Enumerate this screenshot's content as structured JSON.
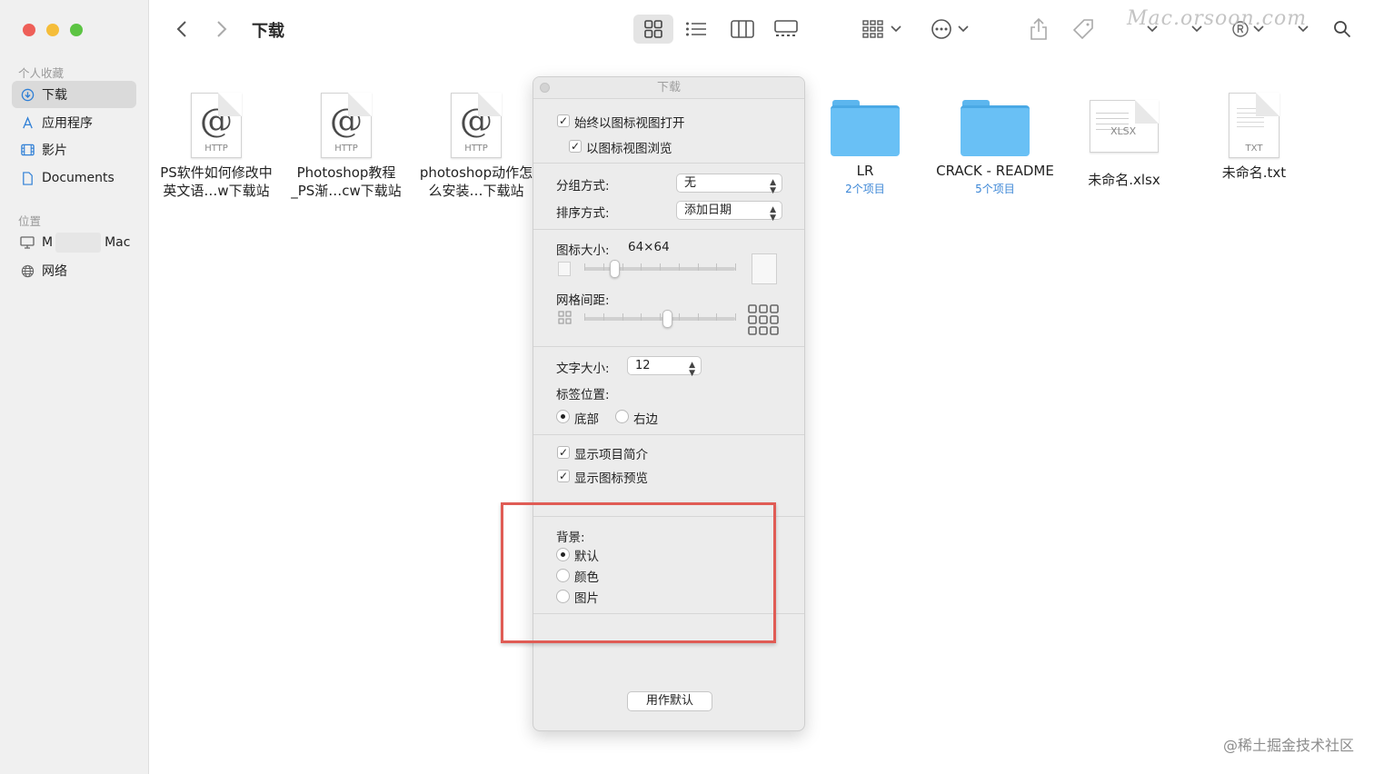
{
  "sidebar": {
    "favorites_title": "个人收藏",
    "items": [
      {
        "label": "下载",
        "icon": "download-circle-icon"
      },
      {
        "label": "应用程序",
        "icon": "applications-icon"
      },
      {
        "label": "影片",
        "icon": "film-icon"
      },
      {
        "label": "Documents",
        "icon": "document-icon"
      }
    ],
    "locations_title": "位置",
    "locations": [
      {
        "label_prefix": "M",
        "label_suffix": "Mac",
        "icon": "computer-icon"
      },
      {
        "label": "网络",
        "icon": "globe-icon"
      }
    ]
  },
  "toolbar": {
    "title": "下载"
  },
  "files": [
    {
      "name": "PS软件如何修改中\n英文语…w下载站",
      "type": "http",
      "icon_label": "HTTP"
    },
    {
      "name": "Photoshop教程\n_PS渐…cw下载站",
      "type": "http",
      "icon_label": "HTTP"
    },
    {
      "name": "photoshop动作怎\n么安装…下载站",
      "type": "http",
      "icon_label": "HTTP"
    },
    {
      "name": "LR",
      "type": "folder",
      "sub": "2个项目"
    },
    {
      "name": "CRACK - README",
      "type": "folder",
      "sub": "5个项目"
    },
    {
      "name": "未命名.xlsx",
      "type": "xlsx",
      "icon_label": "XLSX"
    },
    {
      "name": "未命名.txt",
      "type": "txt",
      "icon_label": "TXT"
    }
  ],
  "panel": {
    "title": "下载",
    "always_open_icon_view": "始终以图标视图打开",
    "browse_icon_view": "以图标视图浏览",
    "group_by_label": "分组方式:",
    "group_by_value": "无",
    "sort_by_label": "排序方式:",
    "sort_by_value": "添加日期",
    "icon_size_label": "图标大小:",
    "icon_size_value": "64×64",
    "icon_size_level": 0.2,
    "grid_spacing_label": "网格间距:",
    "grid_spacing_level": 0.55,
    "text_size_label": "文字大小:",
    "text_size_value": "12",
    "label_position_label": "标签位置:",
    "label_position_bottom": "底部",
    "label_position_right": "右边",
    "show_item_info": "显示项目简介",
    "show_icon_preview": "显示图标预览",
    "background_label": "背景:",
    "bg_default": "默认",
    "bg_color": "颜色",
    "bg_picture": "图片",
    "use_as_default": "用作默认"
  },
  "watermarks": {
    "top": "Mac.orsoon.com",
    "bottom": "@稀土掘金技术社区"
  },
  "colors": {
    "highlight": "#e05c55",
    "folder": "#69c0f5",
    "accent": "#3b86d6"
  }
}
